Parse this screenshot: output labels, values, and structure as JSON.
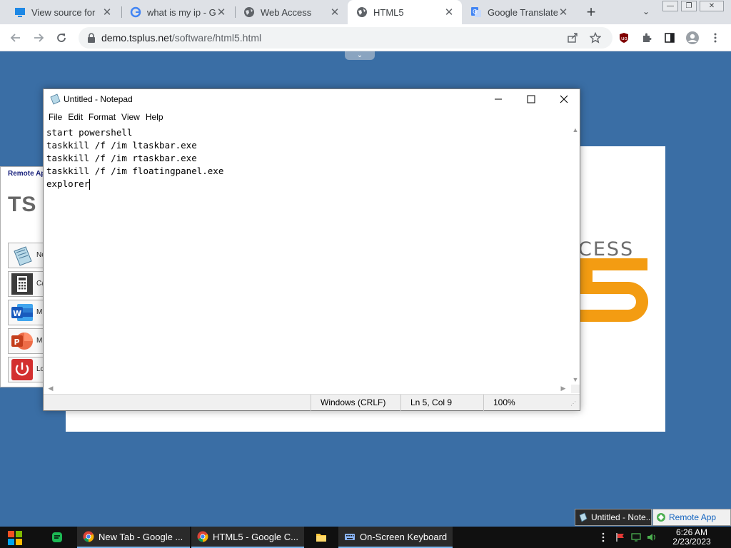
{
  "browser": {
    "tabs": [
      {
        "label": "View source for",
        "icon": "monitor-icon",
        "active": false
      },
      {
        "label": "what is my ip - G",
        "icon": "google-icon",
        "active": false
      },
      {
        "label": "Web Access",
        "icon": "globe-icon",
        "active": false
      },
      {
        "label": "HTML5",
        "icon": "globe-icon",
        "active": true
      },
      {
        "label": "Google Translate",
        "icon": "translate-icon",
        "active": false
      }
    ],
    "new_tab_label": "+",
    "window_buttons": {
      "minimize": "—",
      "restore": "❐",
      "close": "✕"
    },
    "url_host": "demo.tsplus.net",
    "url_path": "/software/html5.html",
    "toolbar_icons": [
      "back-icon",
      "forward-icon",
      "reload-icon",
      "share-icon",
      "star-icon",
      "ublock-icon",
      "extensions-icon",
      "sidepanel-icon",
      "profile-icon",
      "menu-icon"
    ]
  },
  "splash": {
    "access_text": "CESS",
    "accent_color": "#f39c12"
  },
  "remote_apps": {
    "title": "Remote Ap",
    "logo": "TS",
    "items": [
      {
        "label": "No",
        "icon": "notepad-icon"
      },
      {
        "label": "Ca",
        "icon": "calculator-icon"
      },
      {
        "label": "Mi",
        "icon": "word-icon"
      },
      {
        "label": "Mi Po",
        "icon": "powerpoint-icon"
      },
      {
        "label": "Lo",
        "icon": "logoff-icon"
      }
    ]
  },
  "notepad": {
    "title": "Untitled - Notepad",
    "menu": [
      "File",
      "Edit",
      "Format",
      "View",
      "Help"
    ],
    "text": "start powershell\ntaskkill /f /im ltaskbar.exe\ntaskkill /f /im rtaskbar.exe\ntaskkill /f /im floatingpanel.exe\nexplorer",
    "status": {
      "line_ending": "Windows (CRLF)",
      "position": "Ln 5, Col 9",
      "zoom": "100%"
    }
  },
  "remote_taskbar": {
    "tab1": "Untitled - Note...",
    "tab2": "Remote App"
  },
  "taskbar": {
    "apps": [
      {
        "label": "New Tab - Google ...",
        "icon": "chrome-icon"
      },
      {
        "label": "HTML5 - Google C...",
        "icon": "chrome-icon"
      },
      {
        "label": "",
        "icon": "folder-icon"
      },
      {
        "label": "On-Screen Keyboard",
        "icon": "keyboard-icon"
      }
    ],
    "clock_time": "6:26 AM",
    "clock_date": "2/23/2023"
  }
}
